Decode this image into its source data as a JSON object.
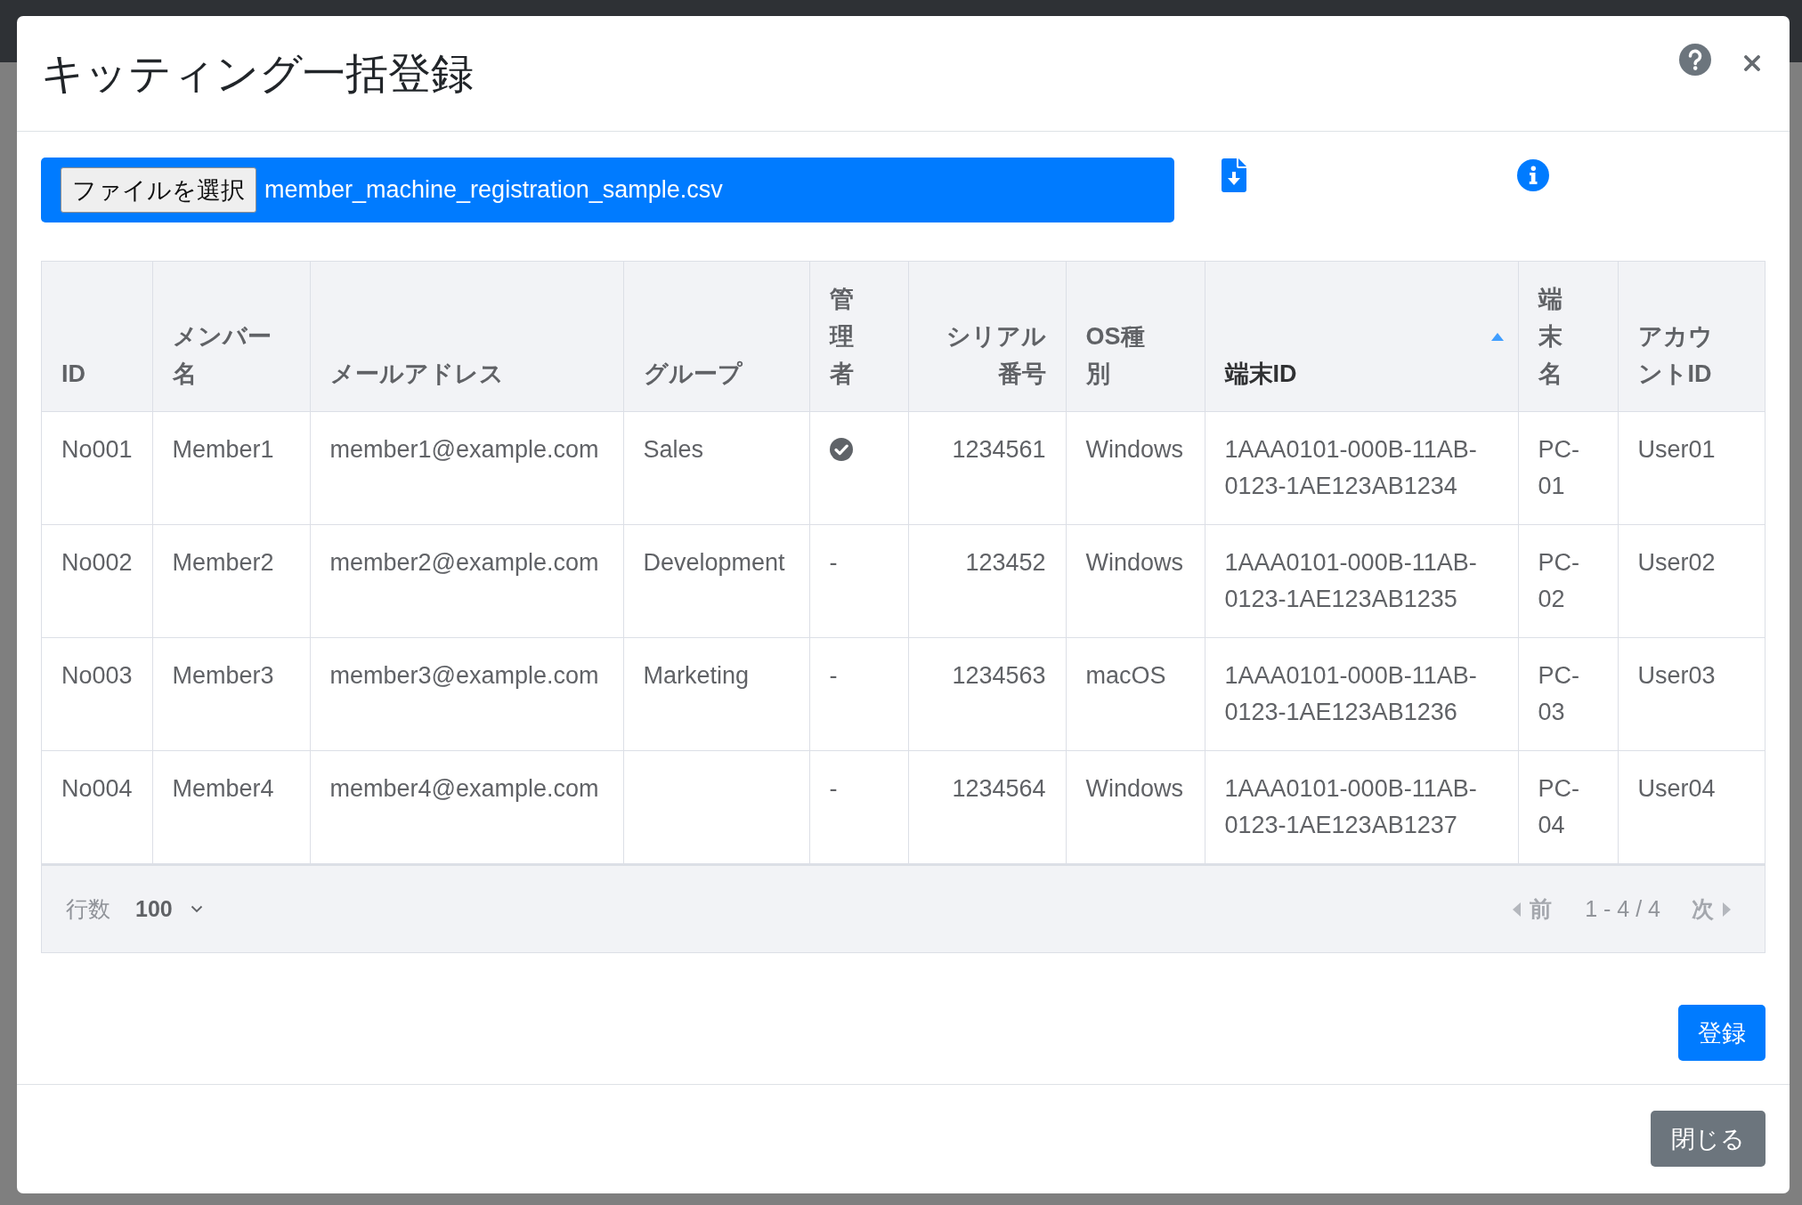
{
  "dialog": {
    "title": "キッティング一括登録"
  },
  "file_input": {
    "button_label": "ファイルを選択",
    "file_name": "member_machine_registration_sample.csv"
  },
  "table": {
    "columns": [
      {
        "label": "ID",
        "align_right": false,
        "sorted": false
      },
      {
        "label": "メンバー名",
        "align_right": false,
        "sorted": false
      },
      {
        "label": "メールアドレス",
        "align_right": false,
        "sorted": false
      },
      {
        "label": "グループ",
        "align_right": false,
        "sorted": false
      },
      {
        "label": "管理者",
        "align_right": false,
        "sorted": false
      },
      {
        "label": "シリアル番号",
        "align_right": true,
        "sorted": false
      },
      {
        "label": "OS種別",
        "align_right": false,
        "sorted": false
      },
      {
        "label": "端末ID",
        "align_right": false,
        "sorted": true
      },
      {
        "label": "端末名",
        "align_right": false,
        "sorted": false
      },
      {
        "label": "アカウントID",
        "align_right": false,
        "sorted": false
      }
    ],
    "rows": [
      {
        "cells": [
          {
            "kind": "text",
            "text": "No001"
          },
          {
            "kind": "text",
            "text": "Member1"
          },
          {
            "kind": "text",
            "text": "member1@example.com"
          },
          {
            "kind": "text",
            "text": "Sales"
          },
          {
            "kind": "check"
          },
          {
            "kind": "text",
            "text": "1234561"
          },
          {
            "kind": "text",
            "text": "Windows"
          },
          {
            "kind": "text",
            "text": "1AAA0101-000B-11AB-0123-1AE123AB1234"
          },
          {
            "kind": "text",
            "text": "PC-01"
          },
          {
            "kind": "text",
            "text": "User01"
          }
        ]
      },
      {
        "cells": [
          {
            "kind": "text",
            "text": "No002"
          },
          {
            "kind": "text",
            "text": "Member2"
          },
          {
            "kind": "text",
            "text": "member2@example.com"
          },
          {
            "kind": "text",
            "text": "Development"
          },
          {
            "kind": "text",
            "text": "-"
          },
          {
            "kind": "text",
            "text": "123452"
          },
          {
            "kind": "text",
            "text": "Windows"
          },
          {
            "kind": "text",
            "text": "1AAA0101-000B-11AB-0123-1AE123AB1235"
          },
          {
            "kind": "text",
            "text": "PC-02"
          },
          {
            "kind": "text",
            "text": "User02"
          }
        ]
      },
      {
        "cells": [
          {
            "kind": "text",
            "text": "No003"
          },
          {
            "kind": "text",
            "text": "Member3"
          },
          {
            "kind": "text",
            "text": "member3@example.com"
          },
          {
            "kind": "text",
            "text": "Marketing"
          },
          {
            "kind": "text",
            "text": "-"
          },
          {
            "kind": "text",
            "text": "1234563"
          },
          {
            "kind": "text",
            "text": "macOS"
          },
          {
            "kind": "text",
            "text": "1AAA0101-000B-11AB-0123-1AE123AB1236"
          },
          {
            "kind": "text",
            "text": "PC-03"
          },
          {
            "kind": "text",
            "text": "User03"
          }
        ]
      },
      {
        "cells": [
          {
            "kind": "text",
            "text": "No004"
          },
          {
            "kind": "text",
            "text": "Member4"
          },
          {
            "kind": "text",
            "text": "member4@example.com"
          },
          {
            "kind": "blank"
          },
          {
            "kind": "text",
            "text": "-"
          },
          {
            "kind": "text",
            "text": "1234564"
          },
          {
            "kind": "text",
            "text": "Windows"
          },
          {
            "kind": "text",
            "text": "1AAA0101-000B-11AB-0123-1AE123AB1237"
          },
          {
            "kind": "text",
            "text": "PC-04"
          },
          {
            "kind": "text",
            "text": "User04"
          }
        ]
      }
    ]
  },
  "pagination": {
    "rows_label": "行数",
    "rows_per_page": "100",
    "prev": {
      "label": "前",
      "disabled": true
    },
    "range": "1 - 4 / 4",
    "next": {
      "label": "次",
      "disabled": true
    }
  },
  "actions": {
    "register": "登録",
    "close": "閉じる"
  }
}
